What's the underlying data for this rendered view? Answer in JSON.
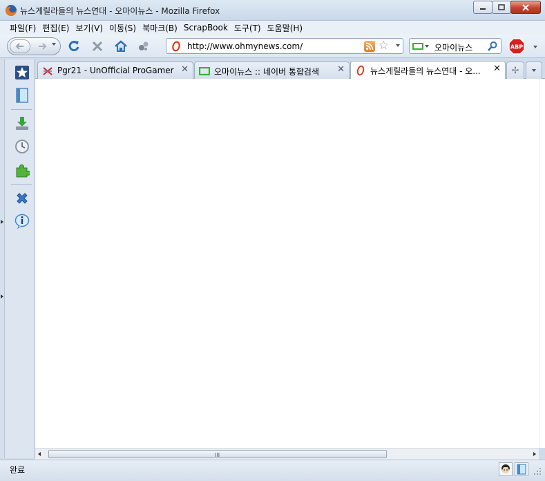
{
  "window": {
    "title": "뉴스게릴라들의 뉴스연대 - 오마이뉴스 - Mozilla Firefox"
  },
  "menu": [
    {
      "label": "파일(F)"
    },
    {
      "label": "편집(E)"
    },
    {
      "label": "보기(V)"
    },
    {
      "label": "이동(S)"
    },
    {
      "label": "북마크(B)"
    },
    {
      "label": "ScrapBook"
    },
    {
      "label": "도구(T)"
    },
    {
      "label": "도움말(H)"
    }
  ],
  "navbar": {
    "url": "http://www.ohmynews.com/",
    "search_engine_text": "오마이뉴스",
    "abp_label": "ABP"
  },
  "tabs": [
    {
      "label": "Pgr21 - UnOfficial ProGamer ...",
      "active": false
    },
    {
      "label": "오마이뉴스 :: 네이버 통합검색",
      "active": false
    },
    {
      "label": "뉴스게릴라들의 뉴스연대 - 오...",
      "active": true
    }
  ],
  "statusbar": {
    "text": "완료"
  },
  "scrollbar": {
    "grip": "III"
  },
  "colors": {
    "ohmynews_red": "#e43a1c",
    "naver_green": "#3aae34",
    "accent_blue": "#2e6fb8"
  }
}
